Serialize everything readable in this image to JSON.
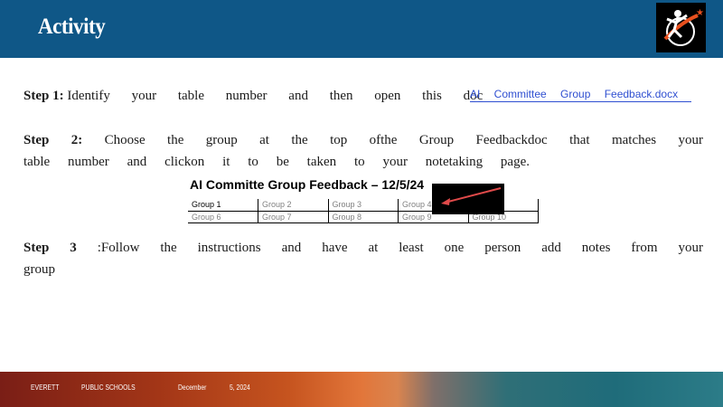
{
  "header": {
    "title": "Activity"
  },
  "steps": [
    {
      "label": "Step 1:",
      "text": "Identify your table number and then open this doc"
    },
    {
      "label": "Step 2:",
      "text_a": "Choose the group at the top ofthe Group Feedbackdoc that matches your",
      "text_b": "table number and clickon it to be taken to your notetaking page."
    },
    {
      "label": "Step 3",
      "text_a": ":Follow the instructions and have at least one person add notes from your",
      "text_b": "group"
    }
  ],
  "doc_link": "AI Committee Group Feedback.docx",
  "feedback": {
    "title": "AI Committe Group Feedback – 12/5/24",
    "row1": [
      "Group 1",
      "Group 2",
      "Group 3",
      "Group 4",
      ""
    ],
    "row2": [
      "Group 6",
      "Group 7",
      "Group 8",
      "Group 9",
      "Group 10"
    ]
  },
  "footer": {
    "org1": "EVERETT",
    "org2": "PUBLIC SCHOOLS",
    "month": "December",
    "date": "5, 2024"
  },
  "colors": {
    "header": "#0f5787",
    "link": "#2f4fd1",
    "arrow": "#e04a4a",
    "logo_accent": "#e8501e"
  },
  "icons": {
    "logo": "eps-logo-icon",
    "arrow": "red-arrow-icon"
  }
}
